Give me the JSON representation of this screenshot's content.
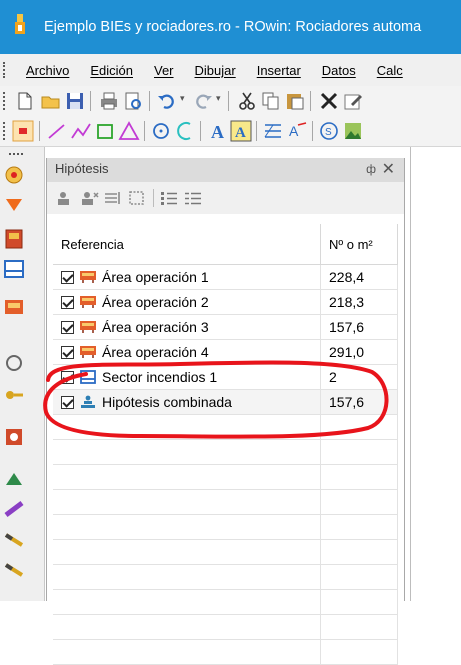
{
  "window": {
    "title": "Ejemplo BIEs y rociadores.ro - ROwin: Rociadores automa"
  },
  "menu": [
    "Archivo",
    "Edición",
    "Ver",
    "Dibujar",
    "Insertar",
    "Datos",
    "Calc"
  ],
  "panel": {
    "title": "Hipótesis",
    "pin_glyph": "ф",
    "close_glyph": "✕",
    "columns": {
      "reference": "Referencia",
      "value": "Nº o m²"
    },
    "rows": [
      {
        "label": "Área operación 1",
        "value": "228,4",
        "icon": "area-operation-icon"
      },
      {
        "label": "Área operación 2",
        "value": "218,3",
        "icon": "area-operation-icon"
      },
      {
        "label": "Área operación 3",
        "value": "157,6",
        "icon": "area-operation-icon"
      },
      {
        "label": "Área operación 4",
        "value": "291,0",
        "icon": "area-operation-icon"
      },
      {
        "label": "Sector incendios 1",
        "value": "2",
        "icon": "fire-sector-icon"
      },
      {
        "label": "Hipótesis combinada",
        "value": "157,6",
        "icon": "combined-hypothesis-icon"
      }
    ]
  },
  "colors": {
    "titlebar": "#1f8fd3",
    "annotation": "#e8141b"
  }
}
